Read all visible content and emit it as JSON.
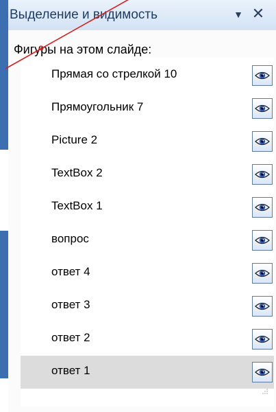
{
  "pane": {
    "title": "Выделение и видимость",
    "dropdown_icon": "triangle-down-icon",
    "close_icon": "close-icon",
    "shapes_label": "Фигуры на этом слайде:"
  },
  "shapes": [
    {
      "name": "Прямая со стрелкой 10",
      "visible": true,
      "selected": false
    },
    {
      "name": "Прямоугольник 7",
      "visible": true,
      "selected": false
    },
    {
      "name": "Picture 2",
      "visible": true,
      "selected": false
    },
    {
      "name": "TextBox 2",
      "visible": true,
      "selected": false
    },
    {
      "name": "TextBox 1",
      "visible": true,
      "selected": false
    },
    {
      "name": "вопрос",
      "visible": true,
      "selected": false
    },
    {
      "name": "ответ 4",
      "visible": true,
      "selected": false
    },
    {
      "name": "ответ 3",
      "visible": true,
      "selected": false
    },
    {
      "name": "ответ 2",
      "visible": true,
      "selected": false
    },
    {
      "name": "ответ 1",
      "visible": true,
      "selected": true
    }
  ],
  "colors": {
    "slide_blue": "#3c6fb1",
    "arrow_red": "#d32020",
    "selected_row": "#dcdcdc"
  }
}
